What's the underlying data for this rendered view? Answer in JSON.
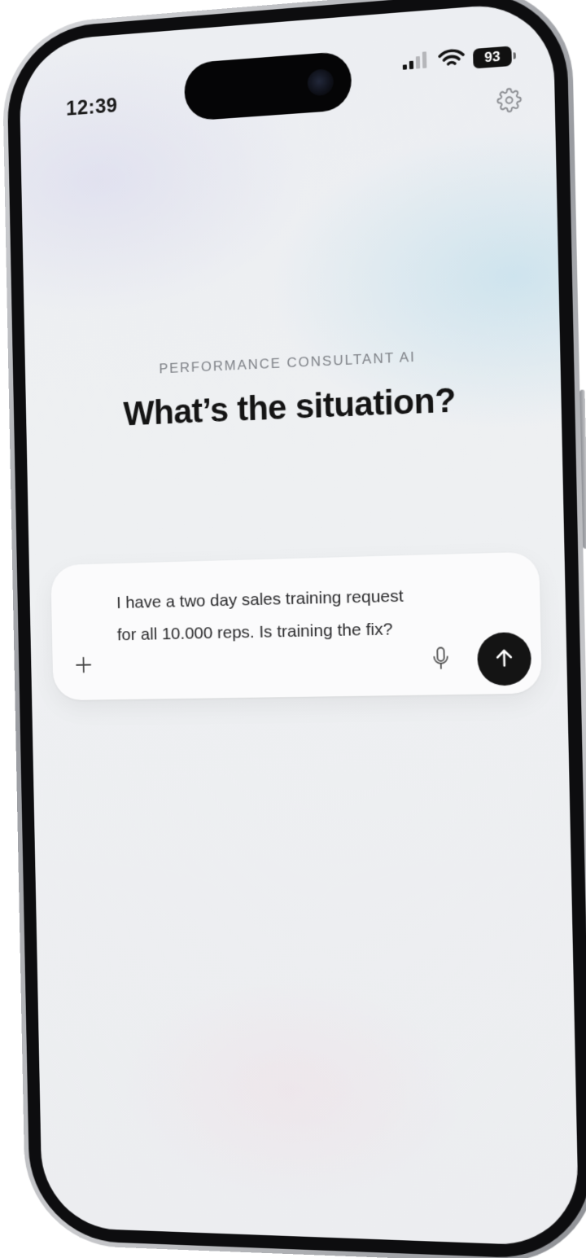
{
  "status_bar": {
    "time": "12:39",
    "battery_level": "93",
    "icons": [
      "cellular-signal-icon",
      "wifi-icon",
      "battery-icon"
    ]
  },
  "header": {
    "settings_icon": "gear-icon"
  },
  "hero": {
    "eyebrow": "PERFORMANCE CONSULTANT AI",
    "headline": "What’s the situation?"
  },
  "composer": {
    "value": "I have a two day sales training request for all 10.000 reps. Is training the fix?",
    "add_icon": "plus-icon",
    "mic_icon": "microphone-icon",
    "send_icon": "arrow-up-icon"
  },
  "colors": {
    "send_button": "#141414",
    "card_background": "#fbfbfc",
    "headline": "#141414",
    "eyebrow": "#7d8086"
  }
}
